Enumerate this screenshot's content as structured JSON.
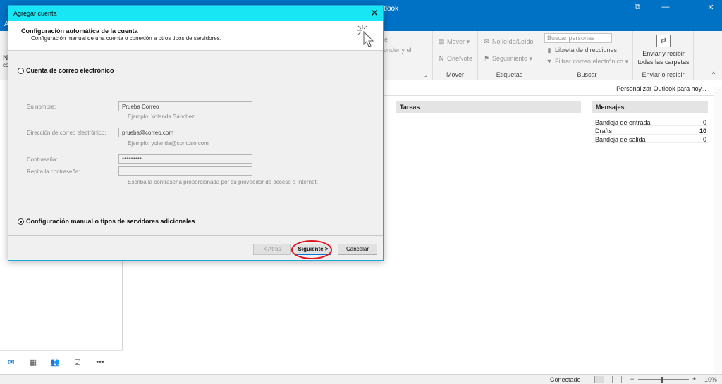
{
  "window": {
    "title_fragment": "tlook"
  },
  "menubar": {
    "tab_a": "A"
  },
  "ribbon": {
    "partial_text_1": "e",
    "partial_text_2": "onder y ell",
    "group_move": {
      "mover": "Mover",
      "onenote": "OneNote",
      "label": "Mover"
    },
    "group_tags": {
      "unread_read": "No leído/Leído",
      "followup": "Seguimiento",
      "label": "Etiquetas"
    },
    "group_find": {
      "search_placeholder": "Buscar personas",
      "address_book": "Libreta de direcciones",
      "filter_email": "Filtrar correo electrónico",
      "label": "Buscar"
    },
    "group_sendrecv": {
      "line1": "Enviar y recibir",
      "line2": "todas las carpetas",
      "label": "Enviar o recibir"
    }
  },
  "leftpane": {
    "stub_n": "N",
    "stub_c": "co"
  },
  "main": {
    "customize": "Personalizar Outlook para hoy...",
    "tasks": {
      "title": "Tareas"
    },
    "messages": {
      "title": "Mensajes",
      "rows": [
        {
          "name": "Bandeja de entrada",
          "count": "0"
        },
        {
          "name": "Drafts",
          "count": "10"
        },
        {
          "name": "Bandeja de salida",
          "count": "0"
        }
      ]
    }
  },
  "status": {
    "connection": "Conectado",
    "zoom": "10%"
  },
  "icons": {
    "mail": "✉",
    "calendar": "▦",
    "people": "👥",
    "tasks": "☑",
    "more": "•••",
    "close": "✕",
    "restore": "⧉",
    "minimize": "—"
  },
  "dialog": {
    "title": "Agregar cuenta",
    "header_title": "Configuración automática de la cuenta",
    "header_subtitle": "Configuración manual de una cuenta o conexión a otros tipos de servidores.",
    "option_email": "Cuenta de correo electrónico",
    "name_label": "Su nombre:",
    "name_value": "Prueba Correo",
    "name_hint": "Ejemplo: Yolanda Sánchez",
    "email_label": "Dirección de correo electrónico:",
    "email_value": "prueba@correo.com",
    "email_hint": "Ejemplo: yolanda@contoso.com",
    "password_label": "Contraseña:",
    "password_value": "*********",
    "repeat_label": "Repita la contraseña:",
    "repeat_value": "",
    "password_hint": "Escriba la contraseña proporcionada por su proveedor de acceso a Internet.",
    "option_manual": "Configuración manual o tipos de servidores adicionales",
    "back_button": "< Atrás",
    "next_button": "Siguiente >",
    "cancel_button": "Cancelar"
  }
}
